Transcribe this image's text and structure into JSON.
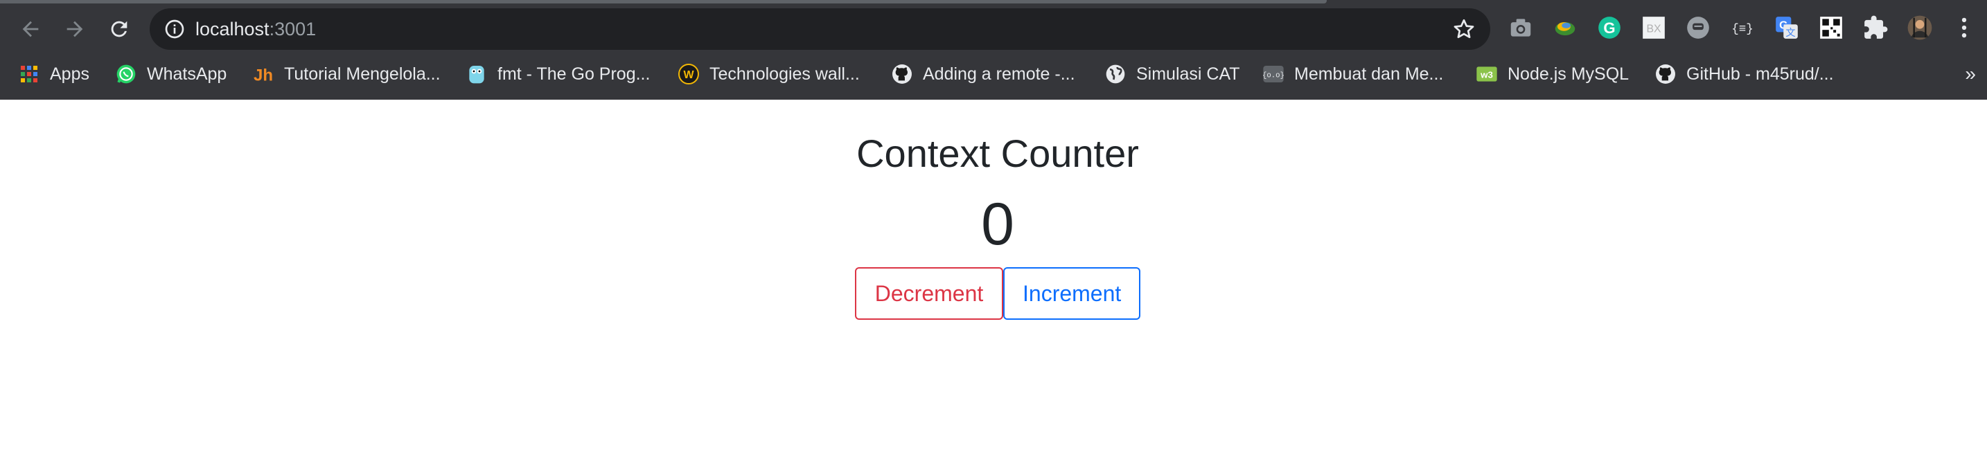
{
  "browser": {
    "url_host": "localhost",
    "url_port": ":3001",
    "extensions": [
      "camera-icon",
      "earth-extension-icon",
      "grammarly-icon",
      "box-extension-icon",
      "chat-extension-icon",
      "json-extension-icon",
      "google-translate-icon",
      "qr-code-icon",
      "puzzle-icon",
      "profile-avatar",
      "menu-dots-icon"
    ],
    "bookmarks": [
      {
        "label": "Apps",
        "icon": "apps-grid-icon"
      },
      {
        "label": "WhatsApp",
        "icon": "whatsapp-icon"
      },
      {
        "label": "Tutorial Mengelola...",
        "icon": "jh-logo-icon"
      },
      {
        "label": "fmt - The Go Prog...",
        "icon": "gopher-icon"
      },
      {
        "label": "Technologies wall...",
        "icon": "w-badge-icon"
      },
      {
        "label": "Adding a remote -...",
        "icon": "github-icon"
      },
      {
        "label": "Simulasi CAT",
        "icon": "globe-icon"
      },
      {
        "label": "Membuat dan Me...",
        "icon": "code-badge-icon"
      },
      {
        "label": "Node.js MySQL",
        "icon": "w3-icon"
      },
      {
        "label": "GitHub - m45rud/...",
        "icon": "github-icon"
      }
    ],
    "more_label": "»"
  },
  "page": {
    "title": "Context Counter",
    "count": "0",
    "decrement_label": "Decrement",
    "increment_label": "Increment"
  },
  "colors": {
    "chrome_bg": "#35363a",
    "omnibox_bg": "#202124",
    "danger": "#dc3545",
    "primary": "#0d6efd",
    "text": "#212529"
  }
}
